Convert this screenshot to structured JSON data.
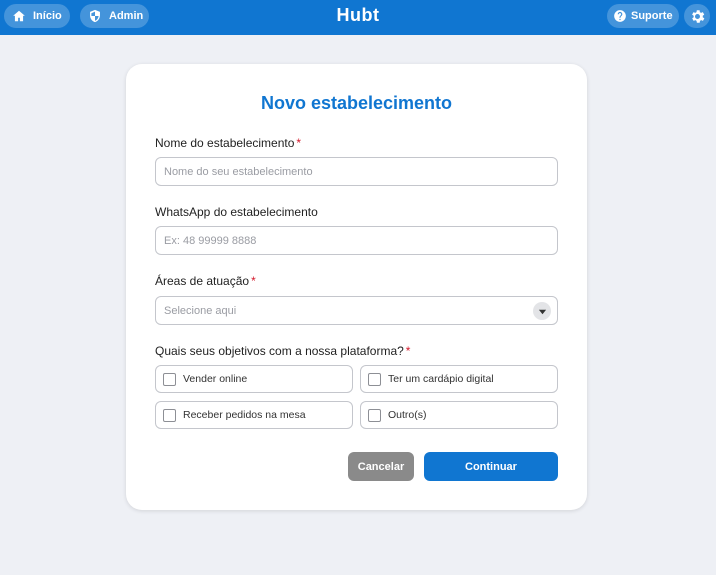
{
  "topbar": {
    "home_label": "Início",
    "admin_label": "Admin",
    "brand": "Hubt",
    "support_label": "Suporte",
    "accent_color": "#1076d1"
  },
  "form": {
    "title": "Novo estabelecimento",
    "required_mark": "*",
    "name": {
      "label": "Nome do estabelecimento",
      "placeholder": "Nome do seu estabelecimento",
      "value": ""
    },
    "whatsapp": {
      "label": "WhatsApp do estabelecimento",
      "placeholder": "Ex: 48 99999 8888",
      "value": ""
    },
    "areas": {
      "label": "Áreas de atuação",
      "placeholder": "Selecione aqui"
    },
    "goals": {
      "label": "Quais seus objetivos com a nossa plataforma?",
      "options": [
        {
          "label": "Vender online",
          "checked": false
        },
        {
          "label": "Ter um cardápio digital",
          "checked": false
        },
        {
          "label": "Receber pedidos na mesa",
          "checked": false
        },
        {
          "label": "Outro(s)",
          "checked": false
        }
      ]
    },
    "cancel_label": "Cancelar",
    "continue_label": "Continuar"
  },
  "icons": {
    "home": "home-icon",
    "admin": "shield-icon",
    "support": "help-circle-icon",
    "settings": "gear-icon",
    "dropdown": "chevron-down-icon"
  }
}
